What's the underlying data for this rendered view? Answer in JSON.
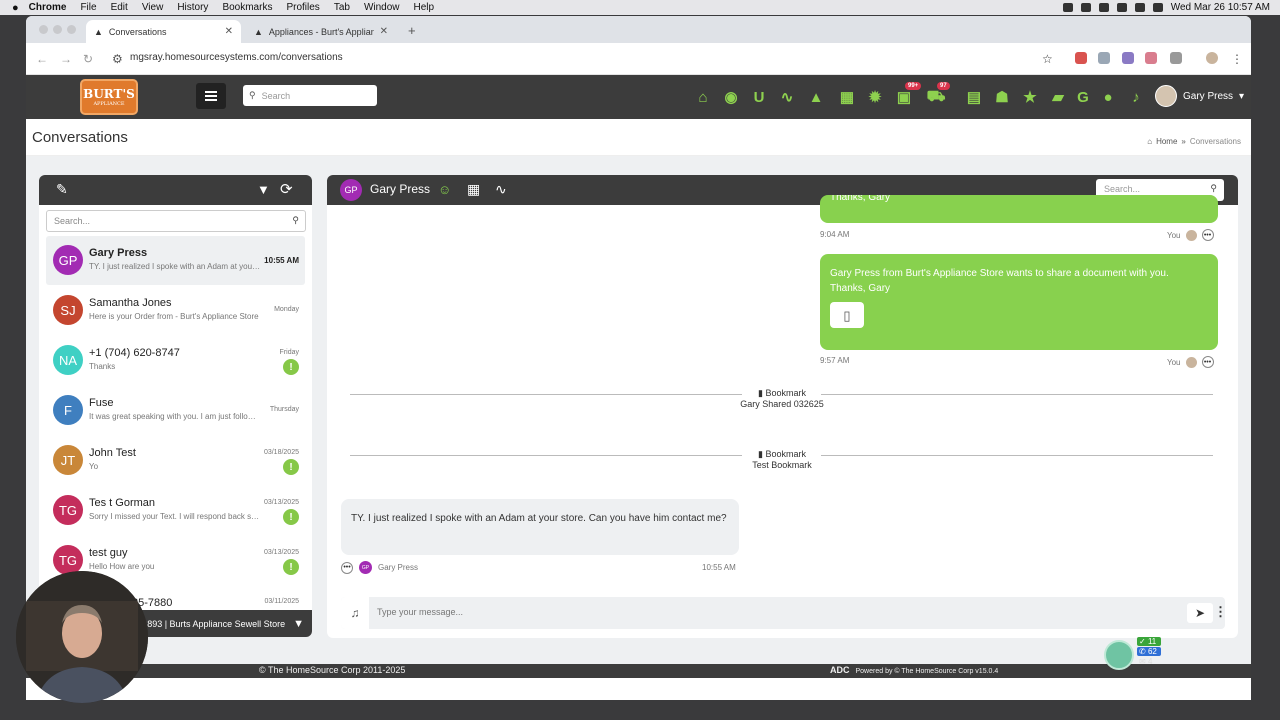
{
  "menubar": {
    "app": "Chrome",
    "items": [
      "File",
      "Edit",
      "View",
      "History",
      "Bookmarks",
      "Profiles",
      "Tab",
      "Window",
      "Help"
    ],
    "datetime": "Wed Mar 26  10:57 AM"
  },
  "browser": {
    "tabs": [
      {
        "title": "Conversations"
      },
      {
        "title": "Appliances - Burt's Appliance"
      }
    ],
    "url": "mgsray.homesourcesystems.com/conversations"
  },
  "app": {
    "logo_text": "BURT'S",
    "logo_sub": "APPLIANCE",
    "search_placeholder": "Search",
    "badges": {
      "tasks": "99+",
      "cart": "97"
    },
    "user_name": "Gary Press",
    "colors": {
      "accent": "#88d14e",
      "header": "#3c3c3c",
      "badge": "#d9344c"
    }
  },
  "page": {
    "title": "Conversations",
    "breadcrumb_home": "Home",
    "breadcrumb_current": "Conversations"
  },
  "conversations": {
    "search_placeholder": "Search...",
    "items": [
      {
        "initials": "GP",
        "name": "Gary Press",
        "preview": "TY. I just realized I spoke with an Adam at your store. Can you have him contact me?",
        "time": "10:55 AM",
        "color": "#a22bb3"
      },
      {
        "initials": "SJ",
        "name": "Samantha Jones",
        "preview": "Here is your Order from - Burt's Appliance Store",
        "time": "Monday",
        "color": "#c4462f"
      },
      {
        "initials": "NA",
        "name": "+1 (704) 620-8747",
        "preview": "Thanks",
        "time": "Friday",
        "color": "#3fd0c4"
      },
      {
        "initials": "F",
        "name": "Fuse",
        "preview": "It was great speaking with you. I am just following up",
        "time": "Thursday",
        "color": "#3f7fbf"
      },
      {
        "initials": "JT",
        "name": "John Test",
        "preview": "Yo",
        "time": "03/18/2025",
        "color": "#c98739"
      },
      {
        "initials": "TG",
        "name": "Tes t Gorman",
        "preview": "Sorry I missed your Text. I will respond back shortly",
        "time": "03/13/2025",
        "color": "#c42d5c"
      },
      {
        "initials": "TG",
        "name": "test guy",
        "preview": "Hello How are you",
        "time": "03/13/2025",
        "color": "#c42d5c"
      },
      {
        "initials": "",
        "name": "85-7880",
        "preview": "",
        "time": "03/11/2025",
        "color": "#888888"
      }
    ],
    "store_label": "893 | Burts Appliance Sewell Store"
  },
  "chat": {
    "contact_initials": "GP",
    "contact_name": "Gary Press",
    "search_placeholder": "Search...",
    "msg1_partial": "Thanks, Gary",
    "msg1_time": "9:04 AM",
    "msg1_sender": "You",
    "msg2_text": "Gary Press from Burt's Appliance Store wants to share a document with you.",
    "msg2_sign": "Thanks, Gary",
    "msg2_time": "9:57 AM",
    "msg2_sender": "You",
    "bookmarks": [
      {
        "label": "Bookmark",
        "name": "Gary Shared 032625"
      },
      {
        "label": "Bookmark",
        "name": "Test Bookmark"
      }
    ],
    "incoming_text": "TY. I just realized I spoke with an Adam at your store. Can you have him contact me?",
    "incoming_sender_initials": "GP",
    "incoming_sender": "Gary Press",
    "incoming_time": "10:55 AM",
    "composer_placeholder": "Type your message..."
  },
  "footer": {
    "copyright": "© The HomeSource Corp 2011-2025",
    "brand": "ADC",
    "powered": "Powered by © The HomeSource Corp  v15.0.4"
  },
  "widget": {
    "count_a": "11",
    "count_b": "62",
    "count_c": "4"
  }
}
